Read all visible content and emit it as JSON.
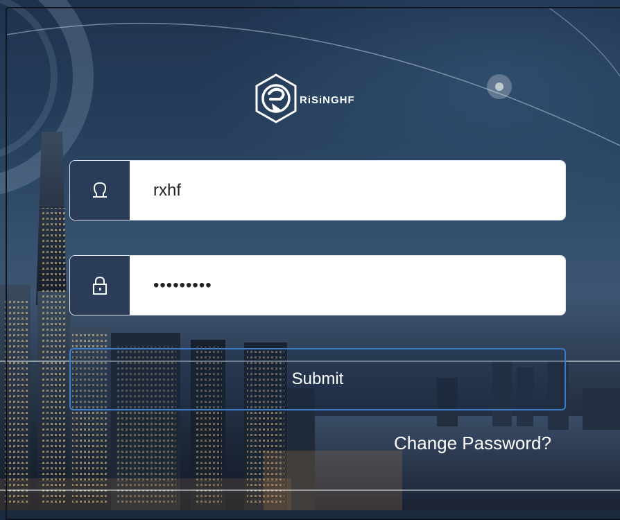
{
  "brand": {
    "name": "RiSiNGHF",
    "icon": "risinghf-hexagon-logo"
  },
  "login": {
    "username": {
      "icon": "user-icon",
      "value": "rxhf"
    },
    "password": {
      "icon": "lock-icon",
      "value": "•••••••••"
    },
    "submit_label": "Submit",
    "change_password_label": "Change Password?"
  },
  "colors": {
    "icon_cell_bg": "#2a3c57",
    "submit_border": "#3b7ecb",
    "text": "#ffffff"
  }
}
